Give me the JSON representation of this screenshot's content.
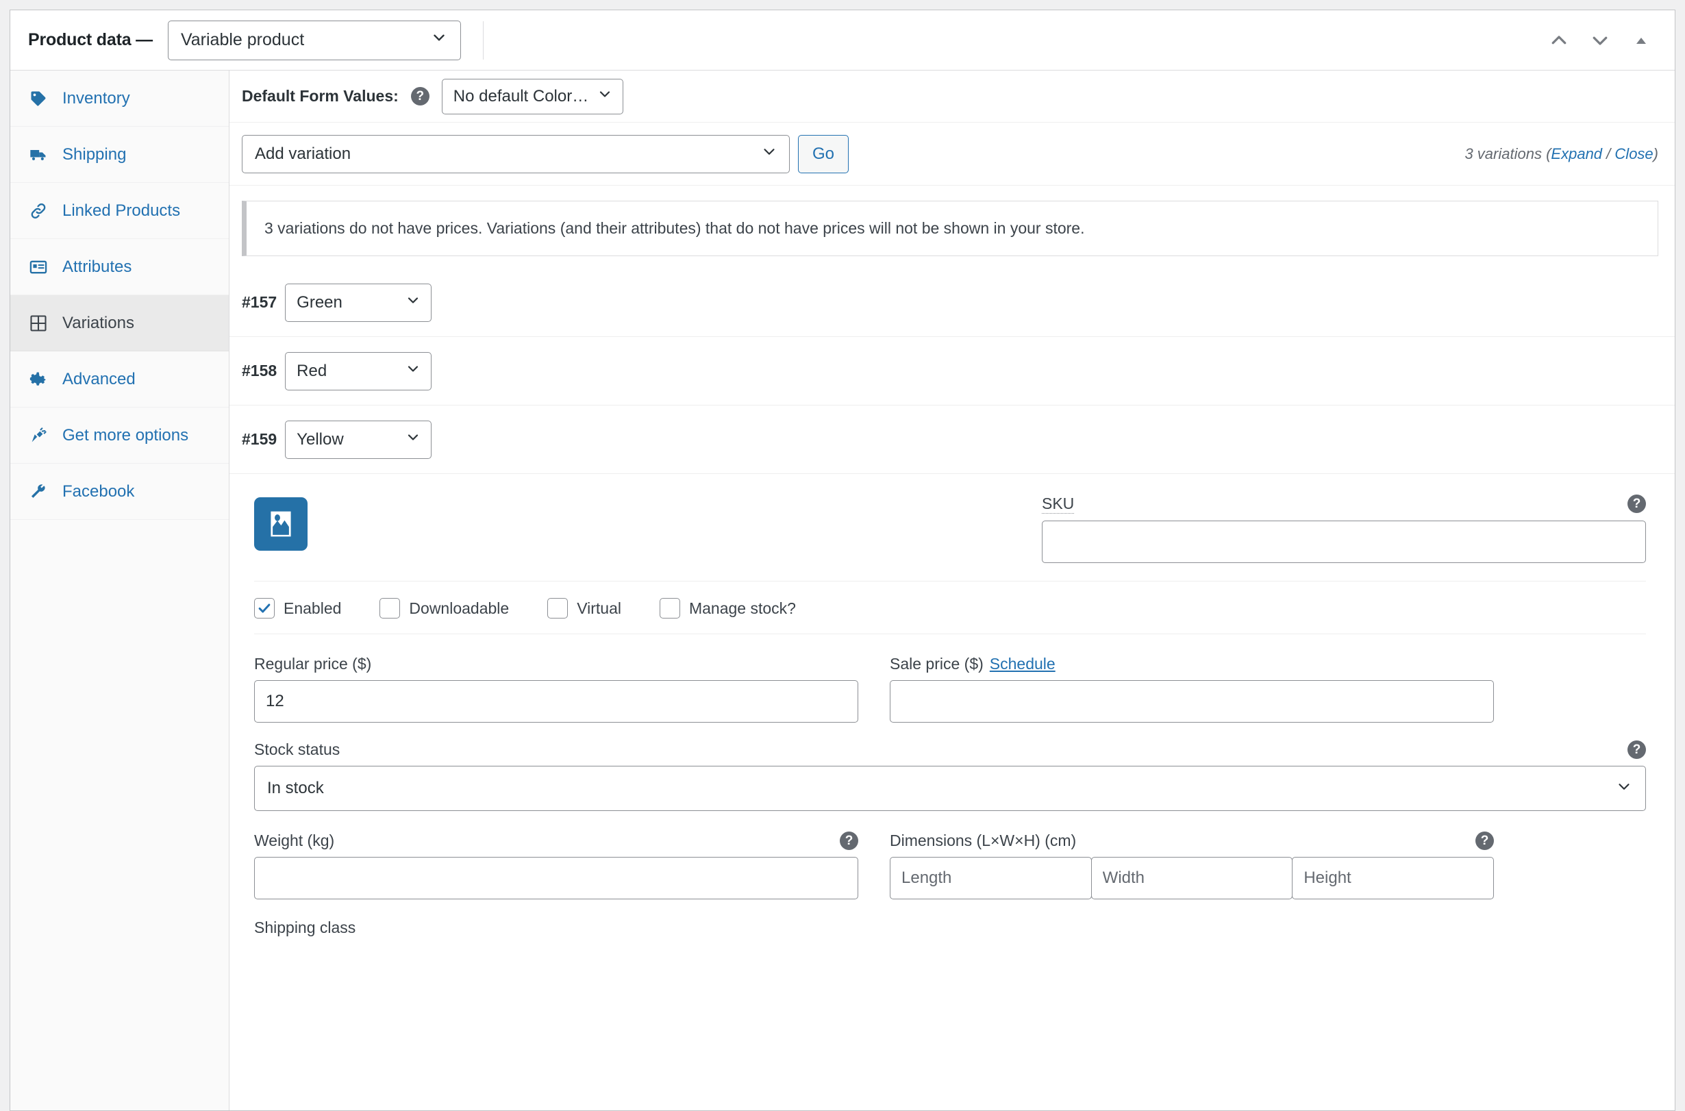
{
  "header": {
    "title": "Product data —",
    "product_type": "Variable product",
    "actions": [
      {
        "name": "move-up-button",
        "icon": "chevron-up-icon"
      },
      {
        "name": "move-down-button",
        "icon": "chevron-down-icon"
      },
      {
        "name": "toggle-panel-button",
        "icon": "triangle-up-icon"
      }
    ]
  },
  "sidebar": {
    "items": [
      {
        "label": "Inventory",
        "icon": "inventory-icon",
        "active": false
      },
      {
        "label": "Shipping",
        "icon": "truck-icon",
        "active": false
      },
      {
        "label": "Linked Products",
        "icon": "link-icon",
        "active": false
      },
      {
        "label": "Attributes",
        "icon": "attributes-icon",
        "active": false
      },
      {
        "label": "Variations",
        "icon": "grid-icon",
        "active": true
      },
      {
        "label": "Advanced",
        "icon": "gear-icon",
        "active": false
      },
      {
        "label": "Get more options",
        "icon": "plug-icon",
        "active": false
      },
      {
        "label": "Facebook",
        "icon": "wrench-icon",
        "active": false
      }
    ]
  },
  "toolbar": {
    "default_form_values_label": "Default Form Values:",
    "default_color_value": "No default Color…",
    "add_variation_value": "Add variation",
    "go_label": "Go",
    "variation_count_text": "3 variations",
    "expand_label": "Expand",
    "separator": "/",
    "close_label": "Close"
  },
  "notice": {
    "text": "3 variations do not have prices. Variations (and their attributes) that do not have prices will not be shown in your store."
  },
  "variations": [
    {
      "id": "#157",
      "color": "Green"
    },
    {
      "id": "#158",
      "color": "Red"
    },
    {
      "id": "#159",
      "color": "Yellow"
    }
  ],
  "detail": {
    "sku_label": "SKU",
    "sku_value": "",
    "checkboxes": [
      {
        "label": "Enabled",
        "checked": true
      },
      {
        "label": "Downloadable",
        "checked": false
      },
      {
        "label": "Virtual",
        "checked": false
      },
      {
        "label": "Manage stock?",
        "checked": false
      }
    ],
    "regular_price_label": "Regular price ($)",
    "regular_price_value": "12",
    "sale_price_label": "Sale price ($)",
    "sale_price_schedule_label": "Schedule",
    "sale_price_value": "",
    "stock_status_label": "Stock status",
    "stock_status_value": "In stock",
    "weight_label": "Weight (kg)",
    "weight_value": "",
    "dimensions_label": "Dimensions (L×W×H) (cm)",
    "dimensions": {
      "length_placeholder": "Length",
      "width_placeholder": "Width",
      "height_placeholder": "Height"
    },
    "shipping_class_label": "Shipping class"
  },
  "colors": {
    "link_blue": "#2271b1",
    "icon_blue": "#2571a7",
    "text_dark": "#2c3338",
    "muted": "#646970",
    "active_bg": "#eaeaea"
  }
}
